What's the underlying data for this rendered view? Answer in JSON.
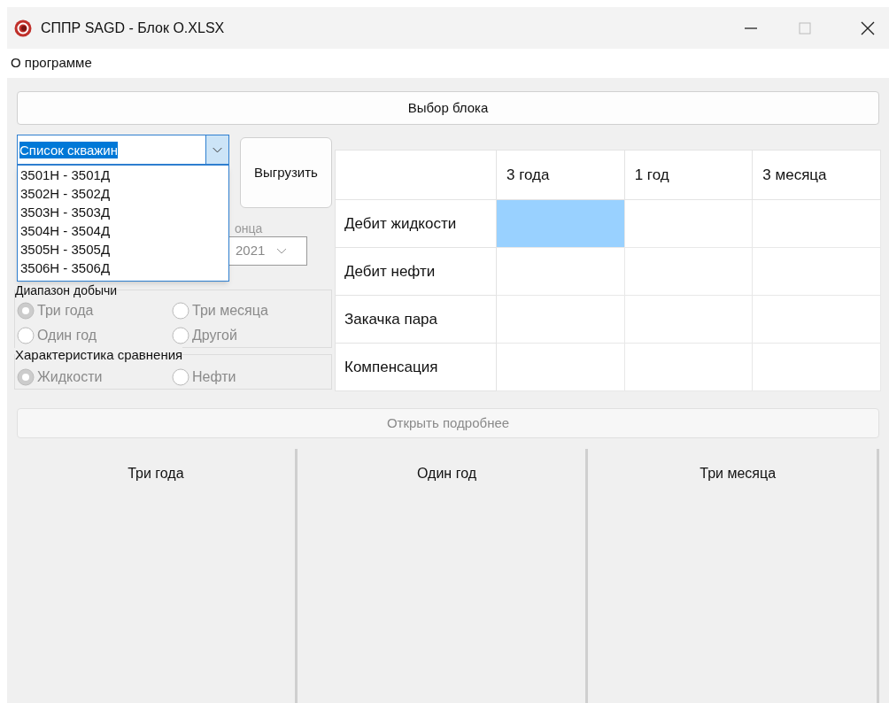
{
  "window": {
    "title": "СППР SAGD - Блок O.XLSX"
  },
  "menu": [
    "О программе"
  ],
  "block_button": "Выбор блока",
  "well_combo": {
    "value": "Список скважин",
    "expanded": true,
    "options": [
      "3501Н - 3501Д",
      "3502Н - 3502Д",
      "3503Н - 3503Д",
      "3504Н - 3504Д",
      "3505Н - 3505Д",
      "3506Н - 3506Д"
    ]
  },
  "export_button": "Выгрузить",
  "end_date": {
    "label": "онца",
    "value": "2021"
  },
  "range_group": {
    "title": "Диапазон добычи",
    "disabled": true,
    "options": [
      {
        "label": "Три года",
        "selected": true
      },
      {
        "label": "Три месяца",
        "selected": false
      },
      {
        "label": "Один год",
        "selected": false
      },
      {
        "label": "Другой",
        "selected": false
      }
    ]
  },
  "compare_group": {
    "title": "Характеристика сравнения",
    "disabled": true,
    "options": [
      {
        "label": "Жидкости",
        "selected": true
      },
      {
        "label": "Нефти",
        "selected": false
      }
    ]
  },
  "table": {
    "columns": [
      "3 года",
      "1 год",
      "3 месяца"
    ],
    "rows": [
      {
        "label": "Дебит жидкости",
        "cells": [
          {
            "selected": true
          },
          {
            "selected": false
          },
          {
            "selected": false
          }
        ]
      },
      {
        "label": "Дебит нефти",
        "cells": [
          {
            "selected": false
          },
          {
            "selected": false
          },
          {
            "selected": false
          }
        ]
      },
      {
        "label": "Закачка пара",
        "cells": [
          {
            "selected": false
          },
          {
            "selected": false
          },
          {
            "selected": false
          }
        ]
      },
      {
        "label": "Компенсация",
        "cells": [
          {
            "selected": false
          },
          {
            "selected": false
          },
          {
            "selected": false
          }
        ]
      }
    ]
  },
  "details_button": {
    "label": "Открыть подробнее",
    "disabled": true
  },
  "panels": [
    "Три года",
    "Один год",
    "Три месяца"
  ]
}
